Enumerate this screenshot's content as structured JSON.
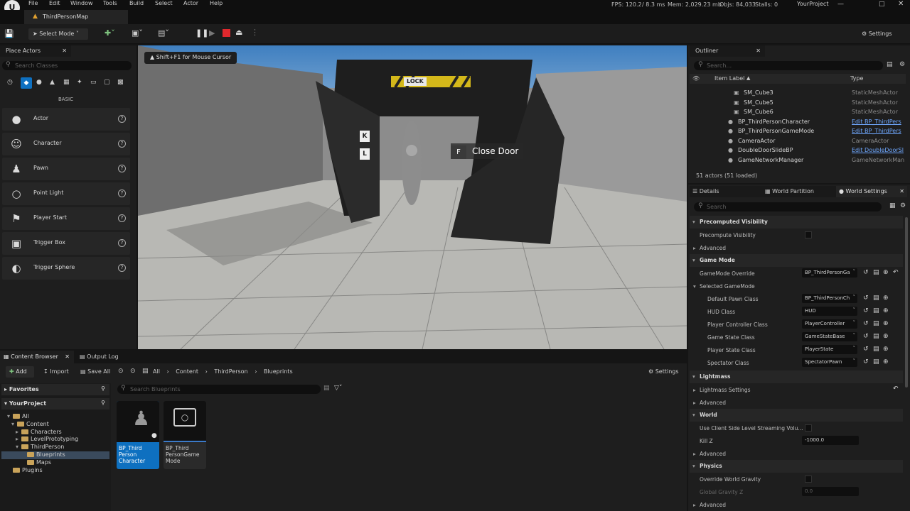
{
  "menu": [
    "File",
    "Edit",
    "Window",
    "Tools",
    "Build",
    "Select",
    "Actor",
    "Help"
  ],
  "logo_text": "U",
  "map_tab": "ThirdPersonMap",
  "stats": {
    "fps": "FPS: 120.2",
    "ms": "/ 8.3 ms",
    "mem": "Mem: 2,029.23 mb",
    "objs": "Objs: 84,033",
    "stalls": "Stalls: 0",
    "project": "YourProject"
  },
  "toolbar": {
    "select_mode": "Select Mode",
    "settings": "Settings"
  },
  "place_actors": {
    "title": "Place Actors",
    "search_placeholder": "Search Classes",
    "category": "BASIC",
    "items": [
      {
        "label": "Actor",
        "icon": "actor-icon"
      },
      {
        "label": "Character",
        "icon": "character-icon"
      },
      {
        "label": "Pawn",
        "icon": "pawn-icon"
      },
      {
        "label": "Point Light",
        "icon": "point-light-icon"
      },
      {
        "label": "Player Start",
        "icon": "player-start-icon"
      },
      {
        "label": "Trigger Box",
        "icon": "trigger-box-icon"
      },
      {
        "label": "Trigger Sphere",
        "icon": "trigger-sphere-icon"
      }
    ]
  },
  "viewport": {
    "hint": "Shift+F1 for Mouse Cursor",
    "sign": "LOCK",
    "prompt_key": "F",
    "prompt_text": "Close Door",
    "door_letters": [
      "K",
      "L"
    ]
  },
  "outliner": {
    "title": "Outliner",
    "search_placeholder": "Search...",
    "col_label": "Item Label",
    "col_type": "Type",
    "rows": [
      {
        "label": "SM_Cube3",
        "type": "StaticMeshActor",
        "link": false
      },
      {
        "label": "SM_Cube5",
        "type": "StaticMeshActor",
        "link": false
      },
      {
        "label": "SM_Cube6",
        "type": "StaticMeshActor",
        "link": false
      },
      {
        "label": "BP_ThirdPersonCharacter",
        "type": "Edit BP_ThirdPers",
        "link": true
      },
      {
        "label": "BP_ThirdPersonGameMode",
        "type": "Edit BP_ThirdPers",
        "link": true
      },
      {
        "label": "CameraActor",
        "type": "CameraActor",
        "link": false
      },
      {
        "label": "DoubleDoorSlideBP",
        "type": "Edit DoubleDoorSl",
        "link": true
      },
      {
        "label": "GameNetworkManager",
        "type": "GameNetworkMan",
        "link": false
      }
    ],
    "count": "51 actors (51 loaded)"
  },
  "details": {
    "tabs": [
      "Details",
      "World Partition",
      "World Settings"
    ],
    "search_placeholder": "Search",
    "precomputed": "Precomputed Visibility",
    "precompute_vis": "Precompute Visibility",
    "advanced": "Advanced",
    "game_mode": "Game Mode",
    "gamemode_override": "GameMode Override",
    "gamemode_override_val": "BP_ThirdPersonGa",
    "selected_gamemode": "Selected GameMode",
    "props": [
      {
        "label": "Default Pawn Class",
        "value": "BP_ThirdPersonCh"
      },
      {
        "label": "HUD Class",
        "value": "HUD"
      },
      {
        "label": "Player Controller Class",
        "value": "PlayerController"
      },
      {
        "label": "Game State Class",
        "value": "GameStateBase"
      },
      {
        "label": "Player State Class",
        "value": "PlayerState"
      },
      {
        "label": "Spectator Class",
        "value": "SpectatorPawn"
      }
    ],
    "lightmass": "Lightmass",
    "lightmass_settings": "Lightmass Settings",
    "world": "World",
    "client_side": "Use Client Side Level Streaming Volu...",
    "kill_z": "Kill Z",
    "kill_z_val": "-1000.0",
    "physics": "Physics",
    "override_gravity": "Override World Gravity",
    "global_gravity": "Global Gravity Z",
    "global_gravity_val": "0.0"
  },
  "content_browser": {
    "tabs": [
      "Content Browser",
      "Output Log"
    ],
    "add": "Add",
    "import": "Import",
    "save_all": "Save All",
    "path": [
      "All",
      "Content",
      "ThirdPerson",
      "Blueprints"
    ],
    "settings": "Settings",
    "favorites": "Favorites",
    "project": "YourProject",
    "search_placeholder": "Search Blueprints",
    "tree": [
      "All",
      "Content",
      "Characters",
      "LevelPrototyping",
      "ThirdPerson",
      "Blueprints",
      "Maps",
      "Plugins"
    ],
    "assets": [
      {
        "label": "BP_Third Person Character"
      },
      {
        "label": "BP_Third PersonGame Mode"
      }
    ]
  },
  "colors": {
    "accent": "#0e70c0",
    "link": "#6fa8ff",
    "folder": "#c9a35a"
  }
}
